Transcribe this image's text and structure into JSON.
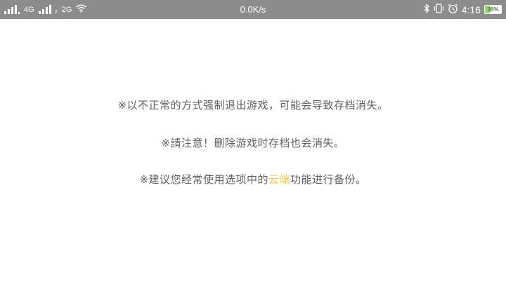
{
  "status_bar": {
    "network_1": "4G",
    "network_2": "2G",
    "network_2_sim": "2",
    "speed": "0.0K/s",
    "time": "4:16",
    "battery_percent": 36,
    "battery_label": "36%"
  },
  "messages": {
    "line1": "※以不正常的方式强制退出游戏，可能会导致存档消失。",
    "line2": "※請注意！删除游戏时存档也会消失。",
    "line3_prefix": "※建议您经常使用选项中的",
    "line3_highlight": "云端",
    "line3_suffix": "功能进行备份。"
  },
  "colors": {
    "status_bar_bg": "#8c8c8c",
    "text": "#5f5f5f",
    "highlight": "#f2c94c"
  }
}
